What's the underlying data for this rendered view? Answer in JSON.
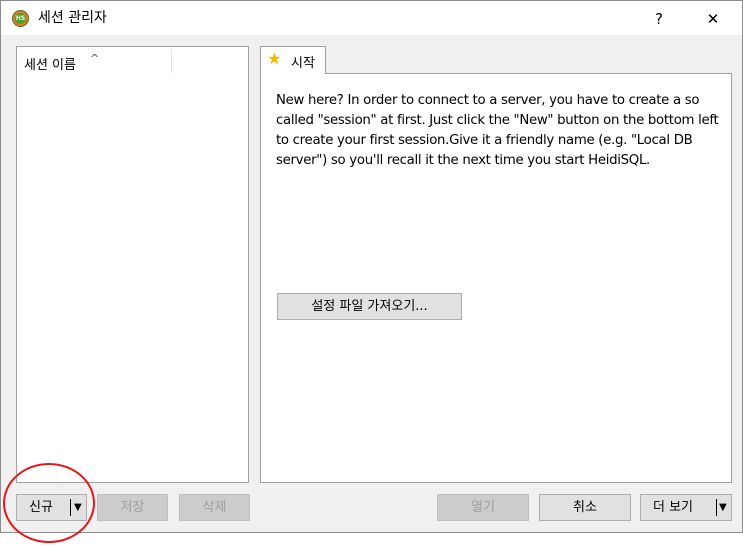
{
  "window": {
    "title": "세션 관리자",
    "help_label": "?",
    "close_label": "✕",
    "app_icon_text": "HS"
  },
  "session_list": {
    "column_header": "세션 이름",
    "sort_indicator": "^"
  },
  "tabs": [
    {
      "label": "시작",
      "icon": "star-icon"
    }
  ],
  "start_tab": {
    "intro_text": "New here? In order to connect to a server, you have to create a so called \"session\" at first. Just click the \"New\" button on the bottom left to create your first session.Give it a friendly name (e.g. \"Local DB server\") so you'll recall it the next time you start HeidiSQL.",
    "import_button_label": "설정 파일 가져오기..."
  },
  "buttons": {
    "new_label": "신규",
    "save_label": "저장",
    "delete_label": "삭제",
    "open_label": "열기",
    "cancel_label": "취소",
    "more_label": "더 보기",
    "dropdown_arrow": "▼"
  },
  "colors": {
    "annotation": "#e4161a",
    "star": "#f5b800"
  }
}
